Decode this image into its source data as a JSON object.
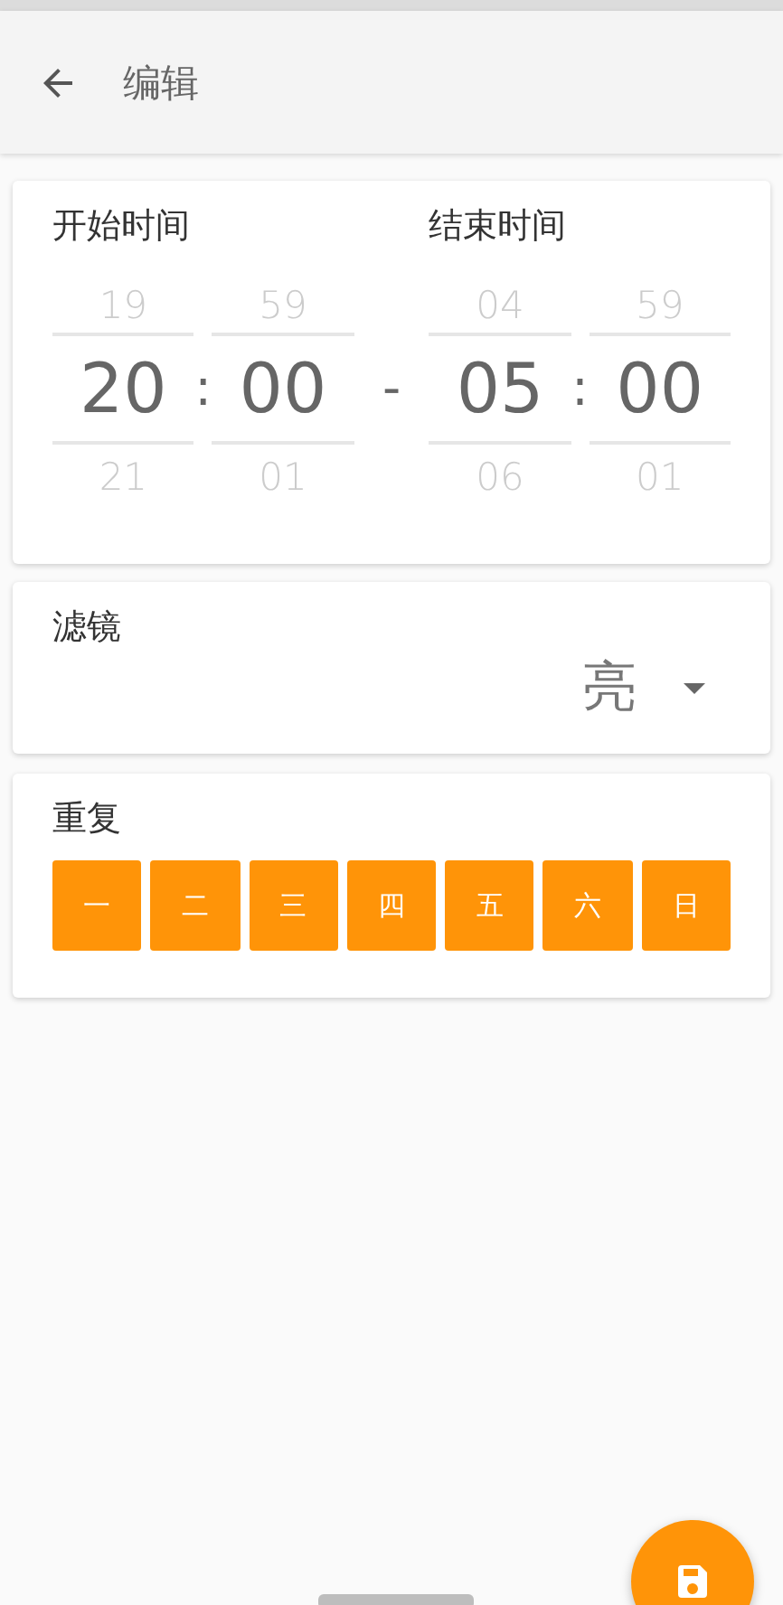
{
  "app_bar": {
    "title": "编辑"
  },
  "time_card": {
    "start_label": "开始时间",
    "end_label": "结束时间",
    "pickers": [
      {
        "above": "19",
        "value": "20",
        "below": "21"
      },
      {
        "above": "59",
        "value": "00",
        "below": "01"
      },
      {
        "above": "04",
        "value": "05",
        "below": "06"
      },
      {
        "above": "59",
        "value": "00",
        "below": "01"
      }
    ],
    "separator": ":",
    "range_separator": "-"
  },
  "filter_card": {
    "label": "滤镜",
    "value": "亮"
  },
  "repeat_card": {
    "label": "重复",
    "days": [
      {
        "label": "一",
        "selected": true
      },
      {
        "label": "二",
        "selected": true
      },
      {
        "label": "三",
        "selected": true
      },
      {
        "label": "四",
        "selected": true
      },
      {
        "label": "五",
        "selected": true
      },
      {
        "label": "六",
        "selected": true
      },
      {
        "label": "日",
        "selected": true
      }
    ]
  }
}
